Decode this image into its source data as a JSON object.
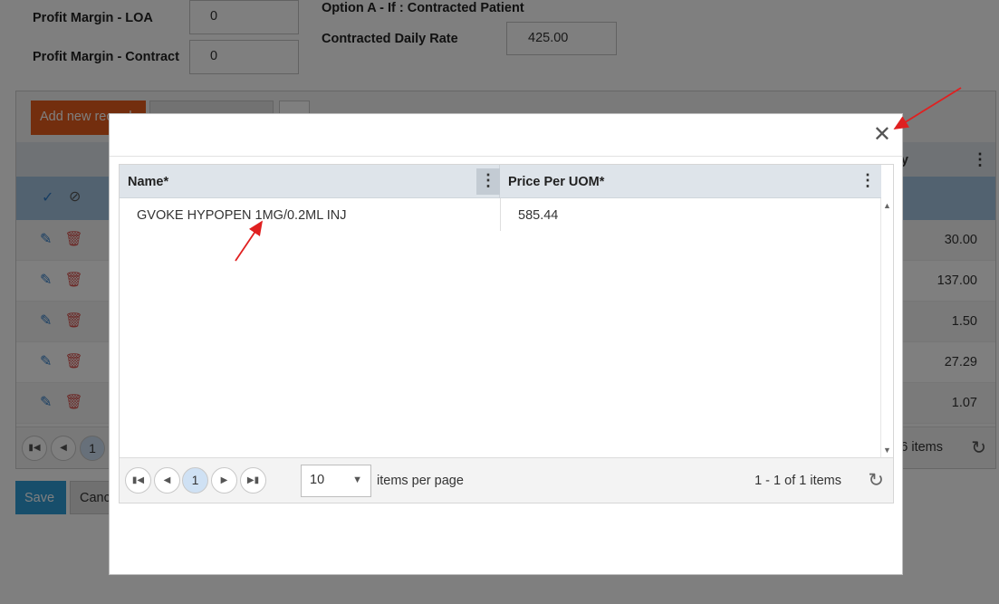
{
  "background": {
    "profit_margin_loa": {
      "label": "Profit Margin - LOA",
      "value": "0"
    },
    "profit_margin_contract": {
      "label": "Profit Margin - Contract",
      "value": "0"
    },
    "option_a_label": "Option A - If : Contracted Patient",
    "contracted_daily_rate": {
      "label": "Contracted Daily Rate",
      "value": "425.00"
    },
    "add_new_record_label": "Add new record",
    "header_partial": "y",
    "row_values": [
      "30.00",
      "137.00",
      "1.50",
      "27.29",
      "1.07"
    ],
    "current_page": "1",
    "items_partial": "6 items",
    "save_label": "Save",
    "cancel_label": "Cancel"
  },
  "modal": {
    "columns": [
      {
        "label": "Name*"
      },
      {
        "label": "Price Per UOM*"
      }
    ],
    "rows": [
      {
        "name": "GVOKE HYPOPEN 1MG/0.2ML INJ",
        "price": "585.44"
      }
    ],
    "pager": {
      "current_page": "1",
      "page_size": "10",
      "items_per_page_label": "items per page",
      "info": "1 - 1 of 1 items"
    },
    "icons": {
      "close": "close-icon",
      "column_menu": "vertical-dots-icon",
      "refresh": "refresh-icon"
    }
  },
  "annotation_color": "#e02020"
}
